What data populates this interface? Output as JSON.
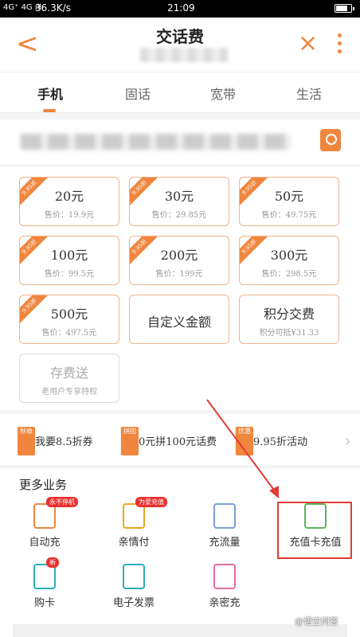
{
  "status_bar": {
    "signal": "4G⁺ 4G ıll",
    "speed": "36.3K/s",
    "time": "21:09"
  },
  "header": {
    "title": "交话费"
  },
  "tabs": [
    {
      "label": "手机"
    },
    {
      "label": "固话"
    },
    {
      "label": "宽带"
    },
    {
      "label": "生活"
    }
  ],
  "ribbon_text": "9.95折",
  "denominations": [
    {
      "amount": "20元",
      "price": "售价：19.9元"
    },
    {
      "amount": "30元",
      "price": "售价：29.85元"
    },
    {
      "amount": "50元",
      "price": "售价：49.75元"
    },
    {
      "amount": "100元",
      "price": "售价：99.5元"
    },
    {
      "amount": "200元",
      "price": "售价：199元"
    },
    {
      "amount": "300元",
      "price": "售价：298.5元"
    },
    {
      "amount": "500元",
      "price": "售价：497.5元"
    }
  ],
  "custom_amount": "自定义金额",
  "points_pay": {
    "title": "积分交费",
    "sub": "积分可抵¥31.33"
  },
  "deposit_gift": {
    "title": "存费送",
    "sub": "老用户专享特权"
  },
  "promos": [
    {
      "tag": "秋收",
      "text": "我要8.5折券"
    },
    {
      "tag": "拼团",
      "text": "0元拼100元话费"
    },
    {
      "tag": "优惠",
      "text": "9.95折活动"
    }
  ],
  "more_services": {
    "title": "更多业务",
    "items": [
      {
        "label": "自动充",
        "badge": "永不停机"
      },
      {
        "label": "亲情付",
        "badge": "为爱充值"
      },
      {
        "label": "充流量",
        "badge": ""
      },
      {
        "label": "充值卡充值",
        "badge": ""
      },
      {
        "label": "购卡",
        "badge": "新"
      },
      {
        "label": "电子发票",
        "badge": ""
      },
      {
        "label": "亲密充",
        "badge": ""
      }
    ]
  },
  "watermark": "@悟空问答"
}
